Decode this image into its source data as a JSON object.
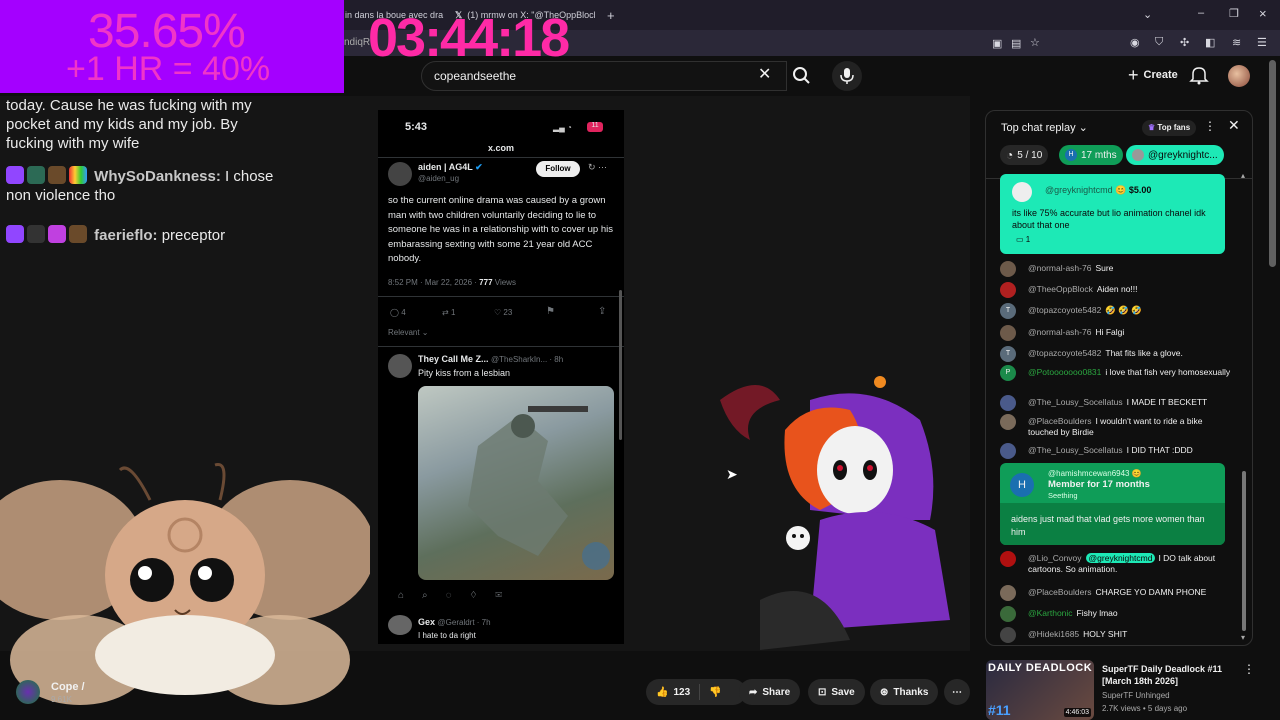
{
  "browser": {
    "tabs": [
      {
        "label": "in dans la boue avec dra"
      },
      {
        "label": "(1) mrmw on X: \"@TheOppBlock"
      }
    ],
    "new_tab_glyph": "+",
    "address_partial": "ndiqR"
  },
  "overlay": {
    "percent_main": "35.65%",
    "percent_sub": "+1 HR = 40%",
    "timer": "03:44:18",
    "chat": [
      {
        "name": "",
        "text": "today. Cause he was fucking with my pocket and my kids and my job. By fucking with my wife"
      },
      {
        "name": "WhySoDankness:",
        "text": " I chose non violence tho"
      },
      {
        "name": "faerieflo:",
        "text": " preceptor"
      }
    ]
  },
  "youtube": {
    "search_value": "copeandseethe",
    "create_label": "Create"
  },
  "tweet_screen": {
    "status_time": "5:43",
    "battery": "11",
    "domain": "x.com",
    "author": "aiden | AG4L",
    "handle": "@aiden_ug",
    "follow": "Follow",
    "body": "so the current online drama was caused by a grown man with two children voluntarily deciding to lie to someone he was in a relationship with to cover up his embarassing sexting with some 21 year old ACC nobody.",
    "timestamp": "8:52 PM · Mar 22, 2026 ·",
    "views_count": "777",
    "views_label": "Views",
    "stats": {
      "replies": "4",
      "reposts": "1",
      "likes": "23"
    },
    "relevant": "Relevant",
    "reply_author": "They Call Me Z...",
    "reply_handle": "@TheSharkIn... · 8h",
    "reply_text": "Pity kiss from a lesbian",
    "reply2_author": "Gex",
    "reply2_handle": "@Geraldrt · 7h",
    "reply2_text": "I hate to                   da right"
  },
  "chat_panel": {
    "title": "Top chat replay",
    "top_fans": "Top fans",
    "chip_score": "5 / 10",
    "chip_months": "17 mths",
    "chip_user": "@greyknightc...",
    "superchat": {
      "author": "@greyknightcmd",
      "amount": "$5.00",
      "text": "its like 75% accurate but lio animation chanel idk about that one",
      "replies": "1"
    },
    "messages": [
      {
        "author": "@normal-ash-76",
        "text": "Sure",
        "color": "#6d5a4a"
      },
      {
        "author": "@TheeOppBlock",
        "text": "Aiden no!!!",
        "color": "#b02020"
      },
      {
        "author": "@topazcoyote5482",
        "text": "🤣 🤣 🤣",
        "color": "#5a6b7a",
        "initial": "T"
      },
      {
        "author": "@normal-ash-76",
        "text": "Hi Falgi",
        "color": "#6d5a4a"
      },
      {
        "author": "@topazcoyote5482",
        "text": "That fits like a glove.",
        "color": "#5a6b7a",
        "initial": "T"
      },
      {
        "author": "@Potooooooo0831",
        "text": "i love that fish very homosexually",
        "color": "#1b8a4a",
        "initial": "P"
      },
      {
        "author": "@The_Lousy_Socellatus",
        "text": "I MADE IT BECKETT",
        "color": "#4a5a8a"
      },
      {
        "author": "@PlaceBoulders",
        "text": "I wouldn't want to ride a bike touched by Birdie",
        "color": "#7a6a5a"
      },
      {
        "author": "@The_Lousy_Socellatus",
        "text": "I DID THAT :DDD",
        "color": "#4a5a8a"
      }
    ],
    "member": {
      "author": "@hamishmcewan6943",
      "title": "Member for 17 months",
      "sub": "Seething",
      "text": "aidens just mad that vlad gets more women than him",
      "initial": "H"
    },
    "messages2": [
      {
        "author": "@Lio_Convoy",
        "mention": "@greyknightcmd",
        "text": "I DO talk about cartoons. So animation.",
        "color": "#b01010"
      },
      {
        "author": "@PlaceBoulders",
        "text": "CHARGE YO DAMN PHONE",
        "color": "#7a6a5a"
      },
      {
        "author": "@Karthonic",
        "text": "Fishy lmao",
        "color": "#3a6a3a"
      },
      {
        "author": "@Hideki1685",
        "text": "HOLY SHIT",
        "color": "#444"
      }
    ]
  },
  "video_actions": {
    "likes": "123",
    "share": "Share",
    "save": "Save",
    "thanks": "Thanks"
  },
  "channel": {
    "name": "Cope /",
    "subs": "9.61K"
  },
  "recommendation": {
    "thumb_title": "DAILY DEADLOCK",
    "episode": "#11",
    "duration": "4:46:03",
    "title": "SuperTF Daily Deadlock #11 [March 18th 2026]",
    "channel": "SuperTF Unhinged",
    "meta": "2.7K views • 5 days ago"
  }
}
